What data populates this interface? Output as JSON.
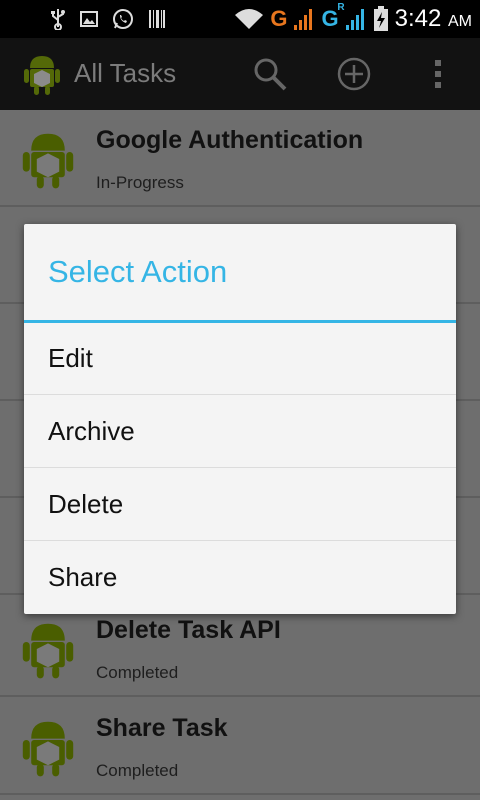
{
  "status_bar": {
    "time": "3:42",
    "ampm": "AM",
    "network_labels": [
      "G",
      "G"
    ],
    "roaming_label": "R"
  },
  "action_bar": {
    "title": "All Tasks",
    "icons": [
      "search-icon",
      "add-icon",
      "overflow-menu-icon"
    ]
  },
  "tasks": [
    {
      "title": "Google Authentication",
      "status": "In-Progress"
    },
    {
      "title": "Delete Task API",
      "status": "Completed"
    },
    {
      "title": "Share Task",
      "status": "Completed"
    }
  ],
  "dialog": {
    "title": "Select Action",
    "items": [
      "Edit",
      "Archive",
      "Delete",
      "Share"
    ]
  },
  "colors": {
    "accent": "#35b5e5",
    "android_green": "#8ab000"
  }
}
